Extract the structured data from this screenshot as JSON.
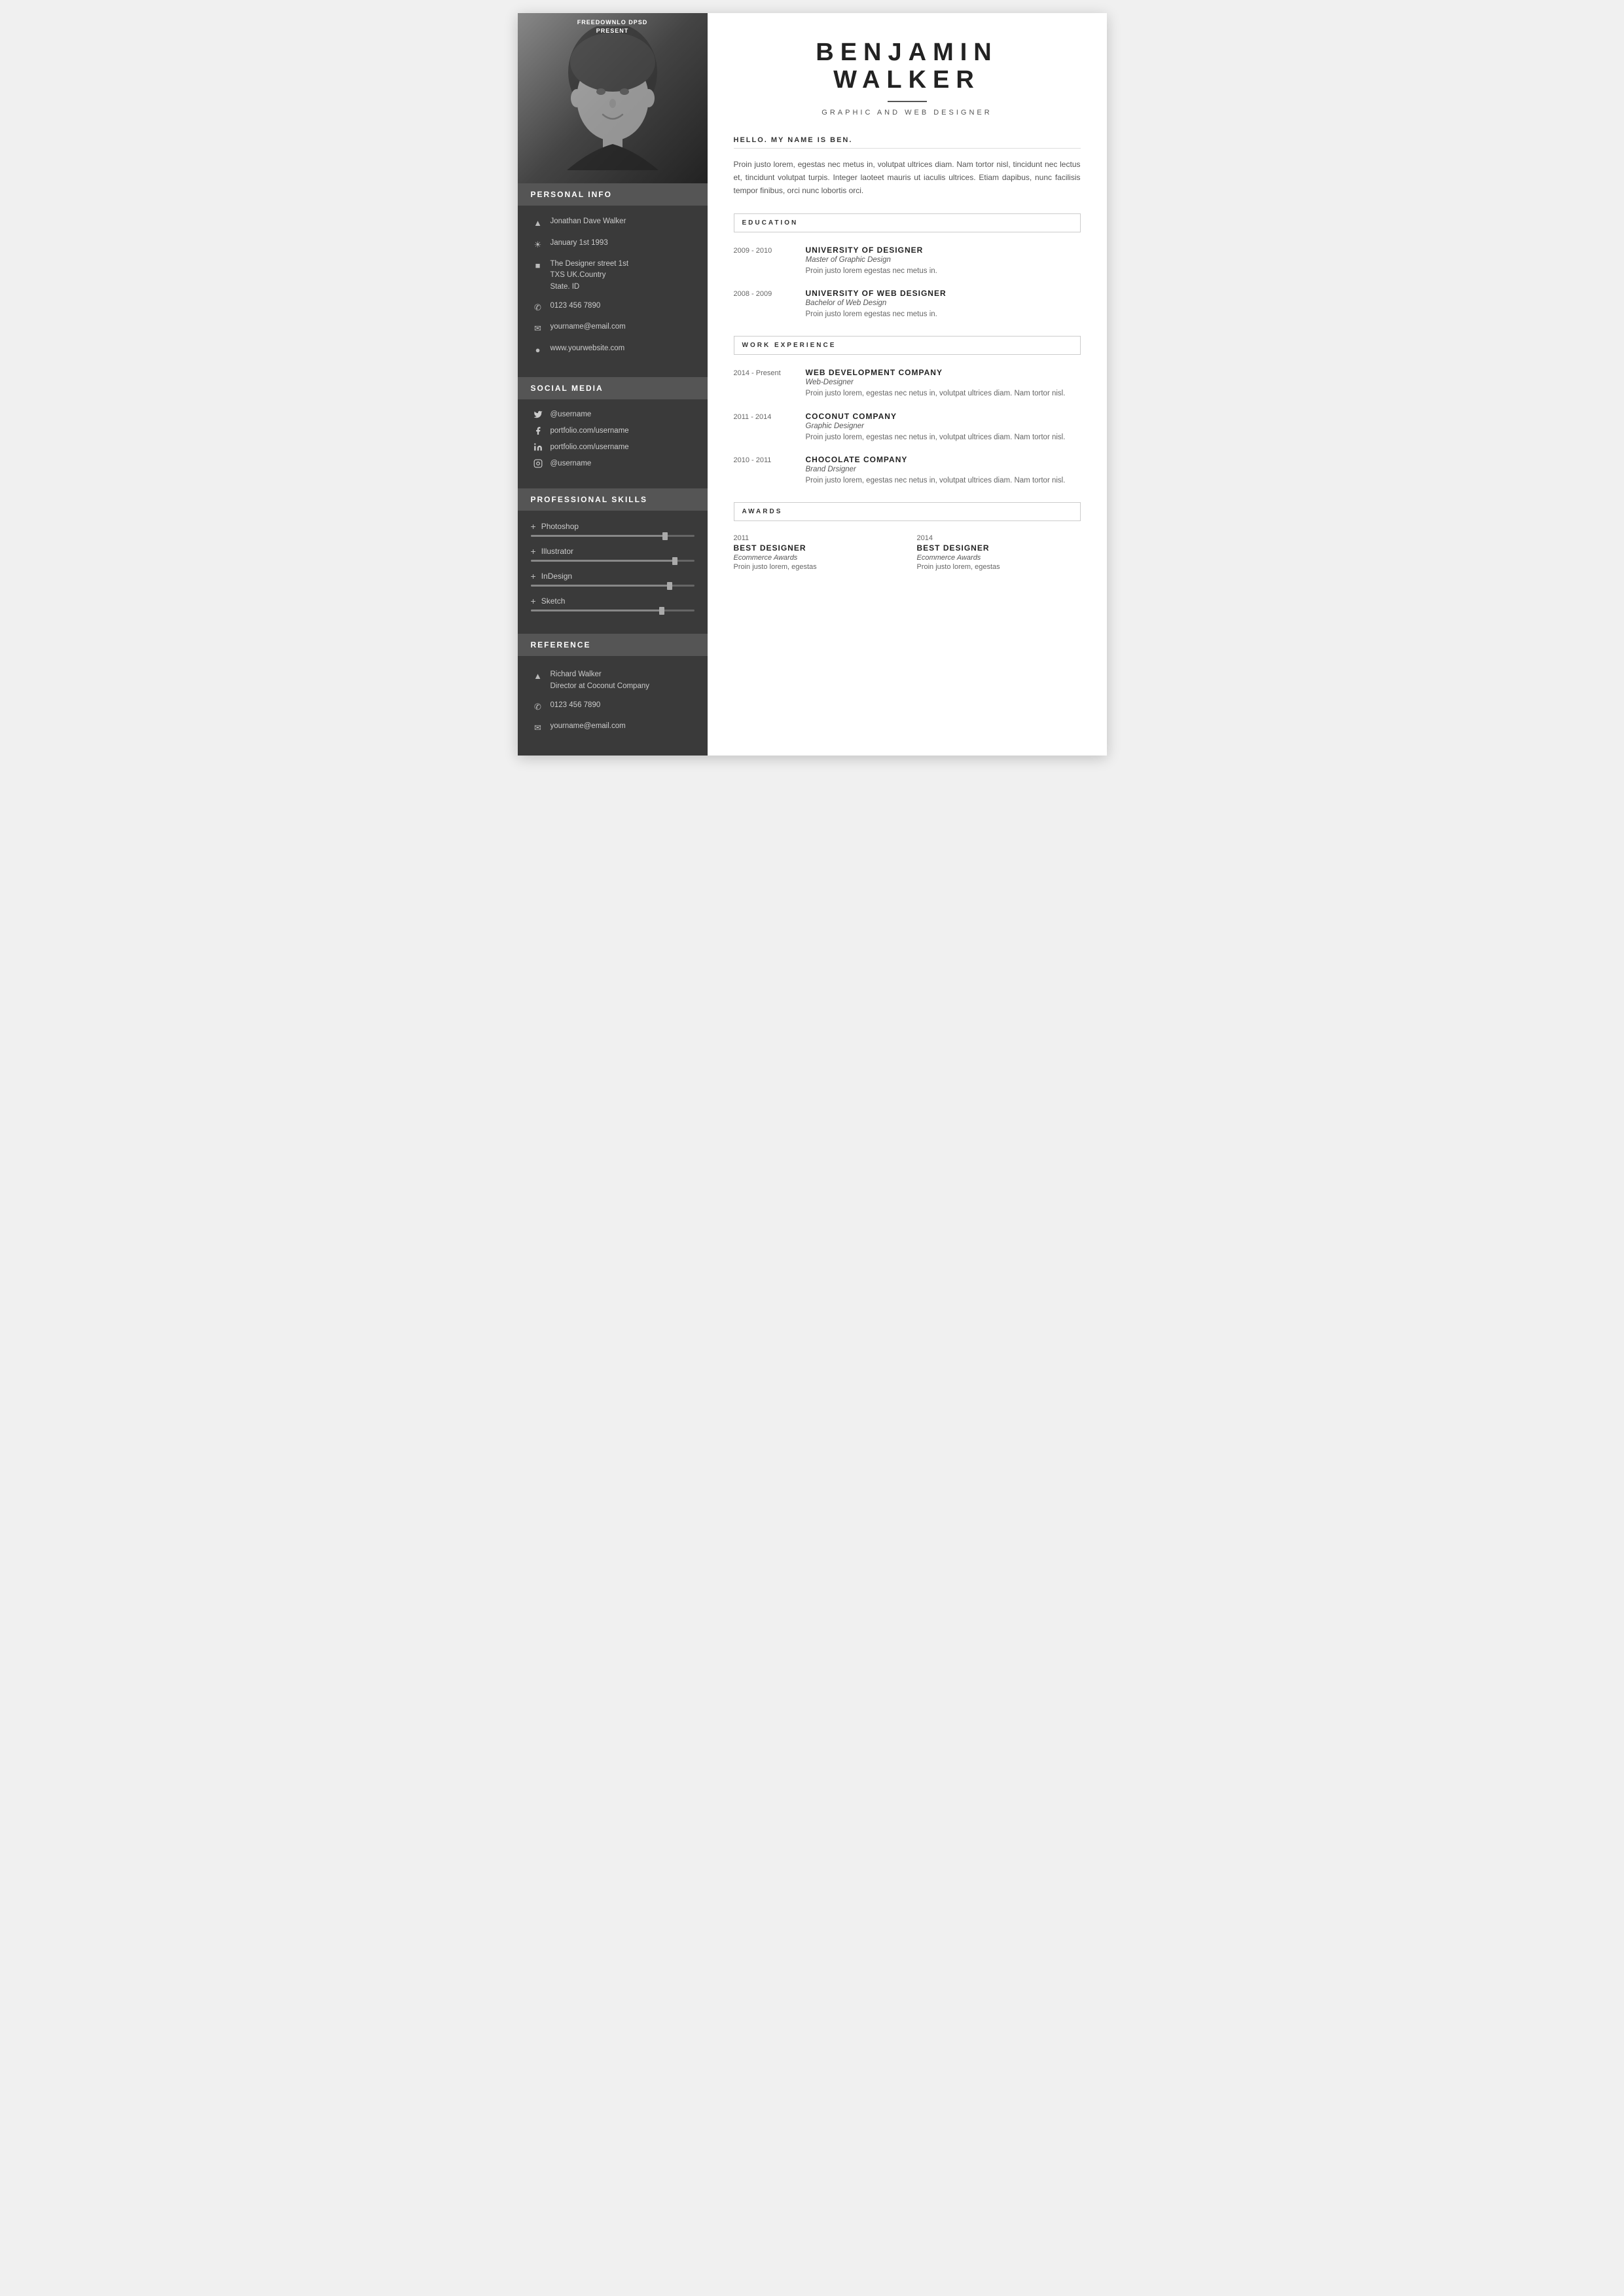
{
  "watermark": {
    "line1": "FREEDOWNLO DPSD",
    "line2": "PRESENT"
  },
  "header": {
    "first_name": "BENJAMIN",
    "last_name": "WALKER",
    "job_title": "GRAPHIC AND WEB DESIGNER"
  },
  "hello": {
    "label": "HELLO. MY NAME IS BEN.",
    "text": "Proin justo lorem, egestas nec metus in, volutpat ultrices diam. Nam tortor nisl, tincidunt nec lectus et, tincidunt volutpat turpis. Integer laoteet mauris ut iaculis ultrices. Etiam dapibus, nunc facilisis tempor finibus, orci nunc lobortis orci."
  },
  "personal_info": {
    "section_title": "PERSONAL INFO",
    "name": "Jonathan Dave Walker",
    "birthday": "January 1st 1993",
    "address": "The Designer street 1st\nTXS UK.Country\nState. ID",
    "phone": "0123 456 7890",
    "email": "yourname@email.com",
    "website": "www.yourwebsite.com"
  },
  "social_media": {
    "section_title": "SOCIAL MEDIA",
    "twitter": "@username",
    "facebook": "portfolio.com/username",
    "linkedin": "portfolio.com/username",
    "instagram": "@username"
  },
  "skills": {
    "section_title": "PROFESSIONAL  SKILLS",
    "items": [
      {
        "name": "Photoshop",
        "percent": 82
      },
      {
        "name": "Illustrator",
        "percent": 88
      },
      {
        "name": "InDesign",
        "percent": 85
      },
      {
        "name": "Sketch",
        "percent": 80
      }
    ]
  },
  "reference": {
    "section_title": "REFERENCE",
    "name": "Richard Walker",
    "title": "Director at Coconut Company",
    "phone": "0123 456 7890",
    "email": "yourname@email.com"
  },
  "education": {
    "section_title": "EDUCATION",
    "entries": [
      {
        "years": "2009 - 2010",
        "school": "UNIVERSITY OF DESIGNER",
        "degree": "Master of Graphic Design",
        "desc": "Proin justo lorem egestas nec metus in."
      },
      {
        "years": "2008 - 2009",
        "school": "UNIVERSITY OF WEB DESIGNER",
        "degree": "Bachelor of Web Design",
        "desc": "Proin justo lorem egestas nec metus in."
      }
    ]
  },
  "work_experience": {
    "section_title": "WORK EXPERIENCE",
    "entries": [
      {
        "years": "2014 - Present",
        "company": "WEB DEVELOPMENT COMPANY",
        "role": "Web-Designer",
        "desc": "Proin justo lorem, egestas nec netus in, volutpat ultrices diam. Nam tortor nisl."
      },
      {
        "years": "2011 - 2014",
        "company": "COCONUT COMPANY",
        "role": "Graphic Designer",
        "desc": "Proin justo lorem, egestas nec netus in, volutpat ultrices diam. Nam tortor nisl."
      },
      {
        "years": "2010 - 2011",
        "company": "CHOCOLATE  COMPANY",
        "role": "Brand Drsigner",
        "desc": "Proin justo lorem, egestas nec netus in, volutpat ultrices diam. Nam tortor nisl."
      }
    ]
  },
  "awards": {
    "section_title": "AWARDS",
    "entries": [
      {
        "year": "2011",
        "title": "BEST  DESIGNER",
        "sub": "Ecommerce Awards",
        "desc": "Proin justo lorem, egestas"
      },
      {
        "year": "2014",
        "title": "BEST  DESIGNER",
        "sub": "Ecommerce Awards",
        "desc": "Proin justo lorem, egestas"
      }
    ]
  }
}
